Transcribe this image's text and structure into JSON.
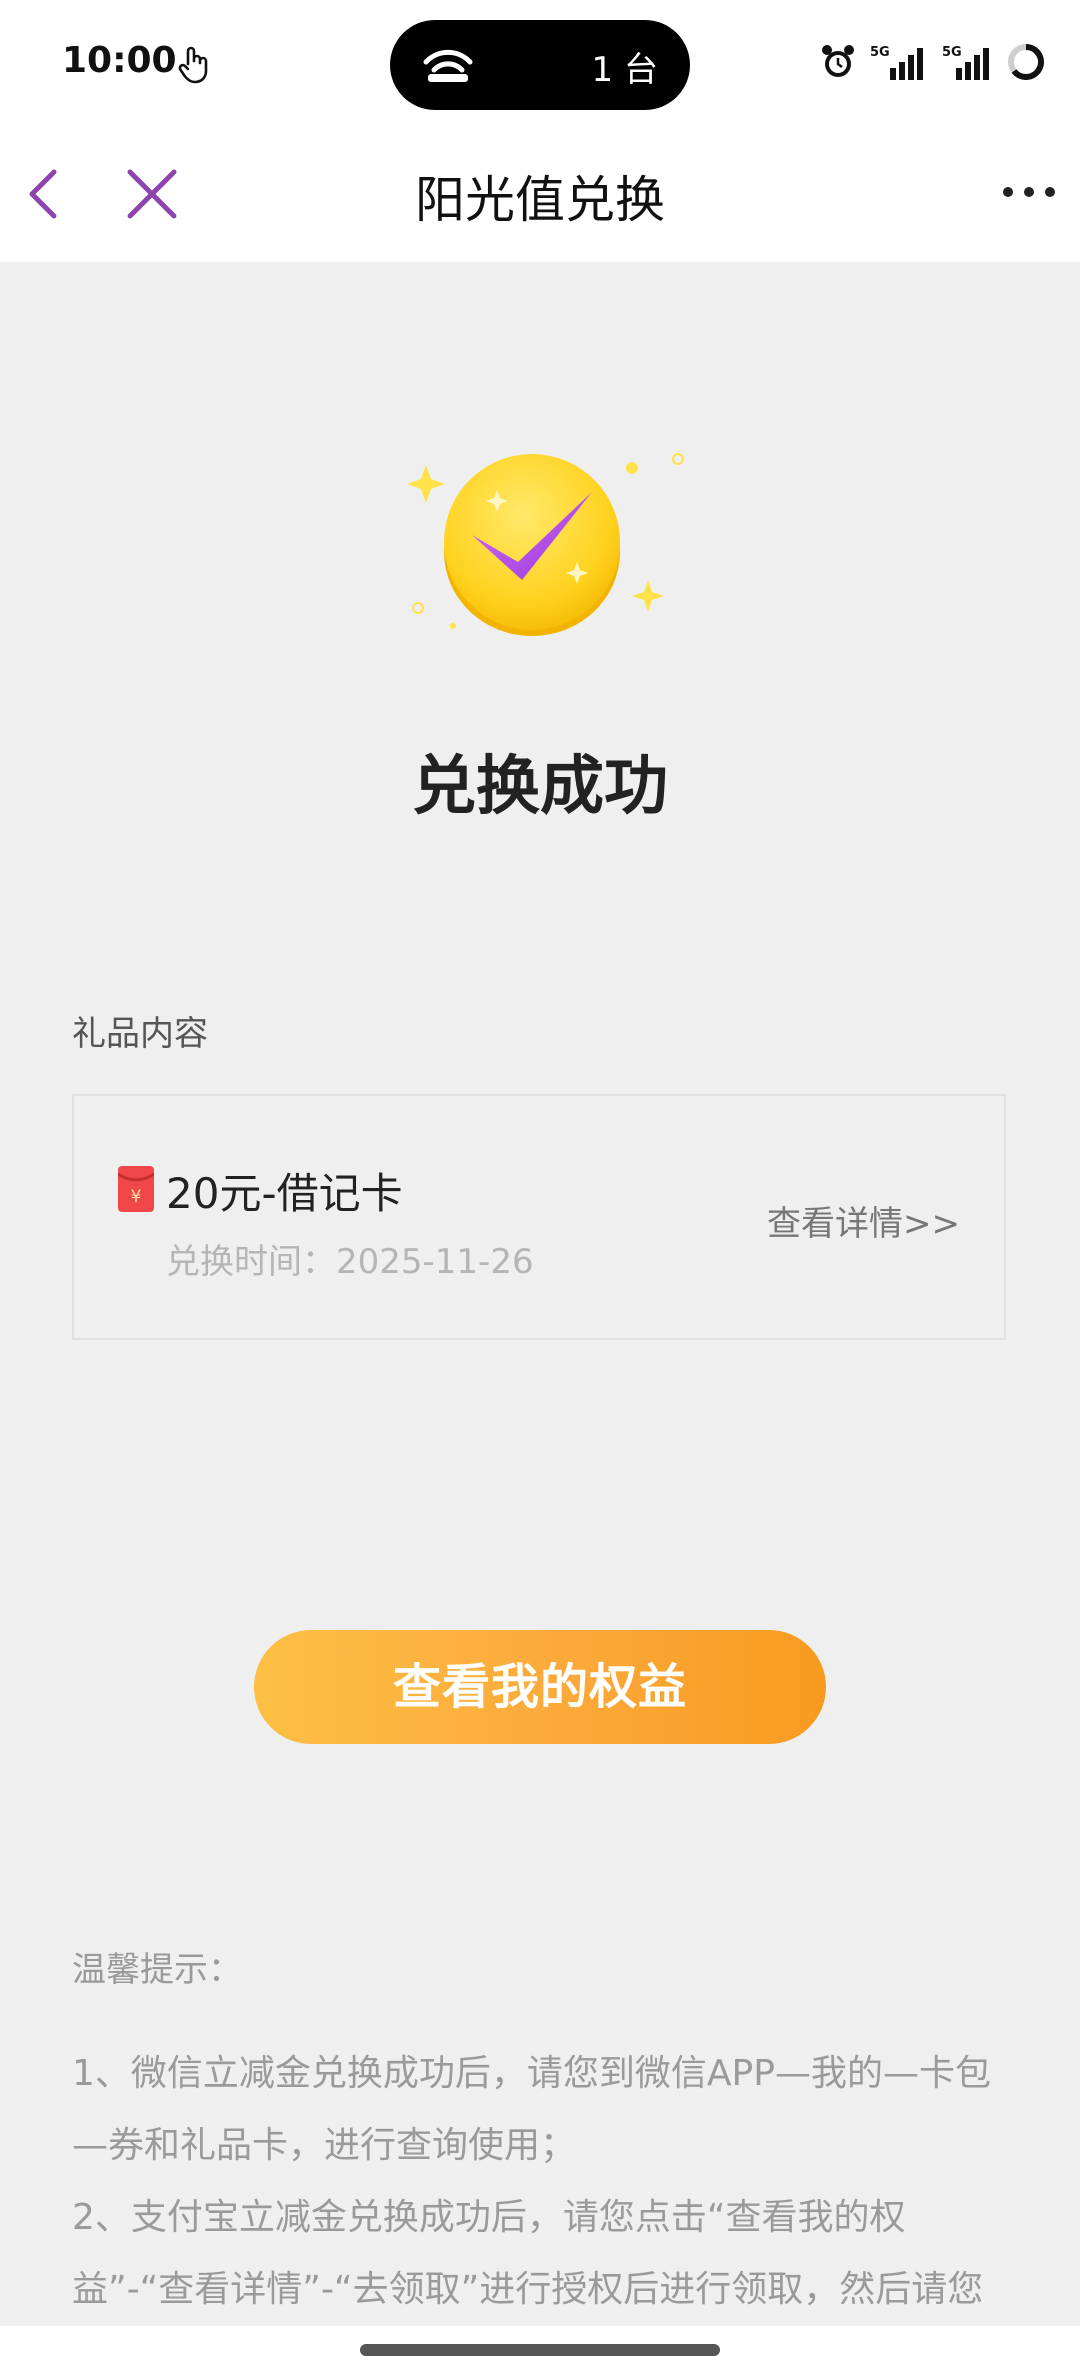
{
  "status_bar": {
    "time": "10:00",
    "cast_label": "1 台",
    "icons": [
      "touch-hand-icon",
      "wifi-icon",
      "alarm-icon",
      "5g-signal-icon",
      "5g-signal-icon",
      "battery-ring-icon"
    ]
  },
  "title_bar": {
    "title": "阳光值兑换",
    "icons": [
      "back-icon",
      "close-icon",
      "more-icon"
    ]
  },
  "result": {
    "icon": "success-check-icon",
    "title": "兑换成功"
  },
  "gift": {
    "section_label": "礼品内容",
    "icon": "red-packet-icon",
    "name": "20元-借记卡",
    "time_label": "兑换时间：",
    "time_value": "2025-11-26",
    "detail_link": "查看详情>>"
  },
  "main_button": {
    "label": "查看我的权益"
  },
  "tips": {
    "title": "温馨提示：",
    "items": [
      "1、微信立减金兑换成功后，请您到微信APP—我的—卡包—券和礼品卡，进行查询使用；",
      "2、支付宝立减金兑换成功后，请您点击“查看我的权益”-“查看详情”-“去领取”进行授权后进行领取，然后请您"
    ]
  },
  "colors": {
    "accent_purple": "#8e44ad",
    "button_orange_start": "#fdbf45",
    "button_orange_end": "#f99a1f",
    "page_background": "#efefef"
  }
}
